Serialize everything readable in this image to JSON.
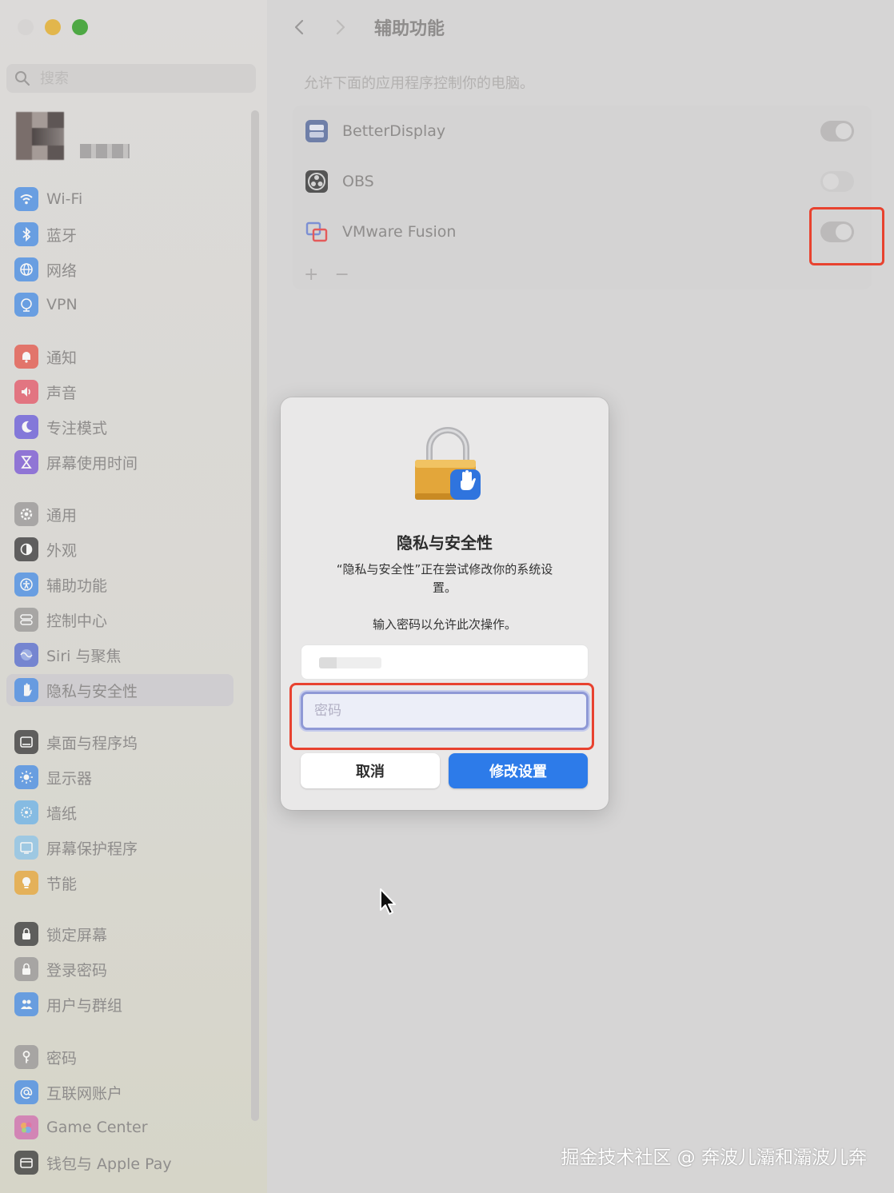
{
  "window": {
    "traffic_lights": [
      "close",
      "minimize",
      "maximize"
    ]
  },
  "sidebar": {
    "search_placeholder": "搜索",
    "groups": [
      [
        {
          "label": "Wi-Fi",
          "icon": "wifi-icon",
          "color": "#4a8ee5"
        },
        {
          "label": "蓝牙",
          "icon": "bluetooth-icon",
          "color": "#4a8ee5"
        },
        {
          "label": "网络",
          "icon": "globe-icon",
          "color": "#4a8ee5"
        },
        {
          "label": "VPN",
          "icon": "vpn-globe-icon",
          "color": "#4a8ee5"
        }
      ],
      [
        {
          "label": "通知",
          "icon": "bell-icon",
          "color": "#e55a4e"
        },
        {
          "label": "声音",
          "icon": "speaker-icon",
          "color": "#e55a6a"
        },
        {
          "label": "专注模式",
          "icon": "moon-icon",
          "color": "#6b5ddb"
        },
        {
          "label": "屏幕使用时间",
          "icon": "hourglass-icon",
          "color": "#7c5ad6"
        }
      ],
      [
        {
          "label": "通用",
          "icon": "gear-icon",
          "color": "#9a9898"
        },
        {
          "label": "外观",
          "icon": "appearance-icon",
          "color": "#3d3d3d"
        },
        {
          "label": "辅助功能",
          "icon": "accessibility-icon",
          "color": "#4a8ee5"
        },
        {
          "label": "控制中心",
          "icon": "control-center-icon",
          "color": "#9a9898"
        },
        {
          "label": "Siri 与聚焦",
          "icon": "siri-icon",
          "color": "#5a6fd0"
        },
        {
          "label": "隐私与安全性",
          "icon": "hand-icon",
          "color": "#4a8ee5",
          "active": true
        }
      ],
      [
        {
          "label": "桌面与程序坞",
          "icon": "dock-icon",
          "color": "#3d3d3d"
        },
        {
          "label": "显示器",
          "icon": "sun-icon",
          "color": "#4a8ee5"
        },
        {
          "label": "墙纸",
          "icon": "wallpaper-icon",
          "color": "#6fb4e8"
        },
        {
          "label": "屏幕保护程序",
          "icon": "screensaver-icon",
          "color": "#8fc4e8"
        },
        {
          "label": "节能",
          "icon": "bulb-icon",
          "color": "#e8a73a"
        }
      ],
      [
        {
          "label": "锁定屏幕",
          "icon": "lock-screen-icon",
          "color": "#3d3d3d"
        },
        {
          "label": "登录密码",
          "icon": "lock-icon",
          "color": "#9a9898"
        },
        {
          "label": "用户与群组",
          "icon": "users-icon",
          "color": "#4a8ee5"
        }
      ],
      [
        {
          "label": "密码",
          "icon": "key-icon",
          "color": "#9a9898"
        },
        {
          "label": "互联网账户",
          "icon": "at-icon",
          "color": "#4a8ee5"
        },
        {
          "label": "Game Center",
          "icon": "game-center-icon",
          "color": "#d16fb0"
        },
        {
          "label": "钱包与 Apple Pay",
          "icon": "wallet-icon",
          "color": "#3d3d3d"
        }
      ]
    ]
  },
  "main": {
    "title": "辅助功能",
    "description": "允许下面的应用程序控制你的电脑。",
    "apps": [
      {
        "name": "BetterDisplay",
        "enabled": true,
        "icon": "betterdisplay-icon"
      },
      {
        "name": "OBS",
        "enabled": false,
        "icon": "obs-icon"
      },
      {
        "name": "VMware Fusion",
        "enabled": true,
        "icon": "vmware-icon"
      }
    ],
    "add_label": "+",
    "remove_label": "−"
  },
  "dialog": {
    "title": "隐私与安全性",
    "message": "“隐私与安全性”正在尝试修改你的系统设置。",
    "prompt": "输入密码以允许此次操作。",
    "username_value": "",
    "password_placeholder": "密码",
    "cancel_label": "取消",
    "confirm_label": "修改设置",
    "accent_color": "#2d7be9",
    "highlight_color": "#e8422f"
  },
  "watermark": "掘金技术社区 @ 奔波儿灞和灞波儿奔"
}
